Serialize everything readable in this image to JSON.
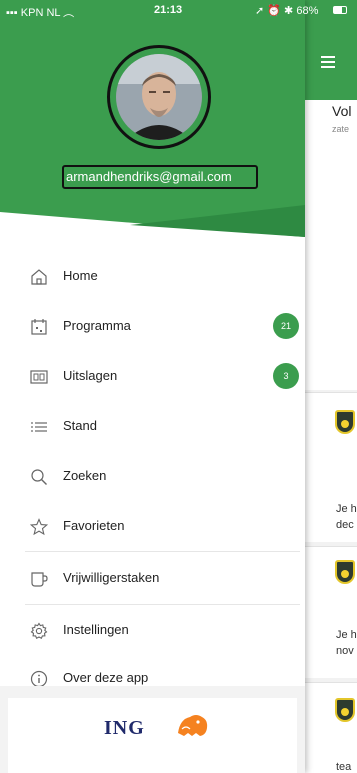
{
  "status_bar": {
    "carrier": "KPN NL",
    "time": "21:13",
    "battery": "68%"
  },
  "user": {
    "email": "armandhendriks@gmail.com"
  },
  "menu": {
    "items": [
      {
        "label": "Home",
        "icon": "home-icon"
      },
      {
        "label": "Programma",
        "icon": "calendar-icon",
        "badge": "21"
      },
      {
        "label": "Uitslagen",
        "icon": "scoreboard-icon",
        "badge": "3"
      },
      {
        "label": "Stand",
        "icon": "list-icon"
      },
      {
        "label": "Zoeken",
        "icon": "search-icon"
      },
      {
        "label": "Favorieten",
        "icon": "star-icon"
      },
      {
        "label": "Vrijwilligerstaken",
        "icon": "cup-icon"
      },
      {
        "label": "Instellingen",
        "icon": "gear-icon"
      },
      {
        "label": "Over deze app",
        "icon": "info-icon"
      }
    ]
  },
  "sponsor": {
    "name": "ING"
  },
  "background_app": {
    "title": "Vol",
    "subtitle": "zate",
    "card_texts": [
      "Je h",
      "dec",
      "Je h",
      "nov",
      "tea"
    ]
  },
  "colors": {
    "primary_green": "#3b9d4e",
    "dark_green": "#2e8a42",
    "ing_blue": "#202a6b",
    "ing_orange": "#f58220"
  }
}
